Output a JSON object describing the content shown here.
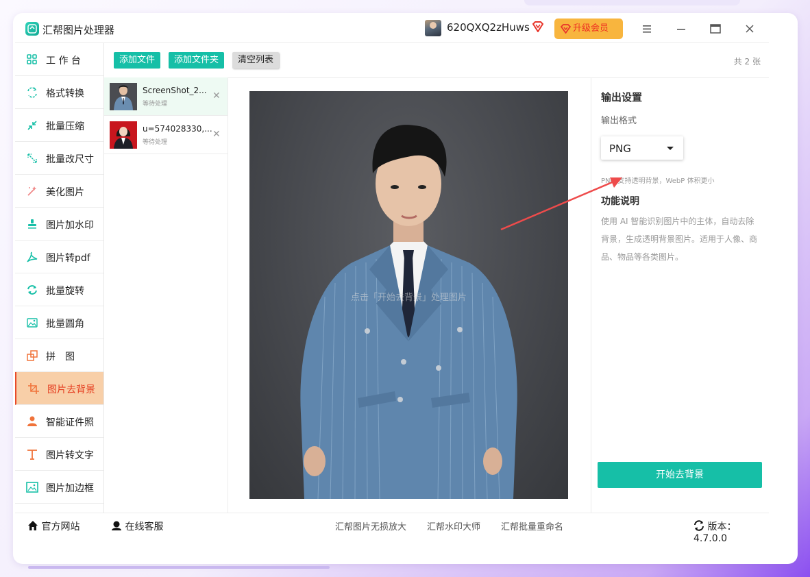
{
  "app": {
    "title": "汇帮图片处理器",
    "username": "620QXQ2zHuws",
    "upgrade_label": "升级会员"
  },
  "sidebar": {
    "items": [
      {
        "label": "工 作 台",
        "icon": "grid-icon"
      },
      {
        "label": "格式转换",
        "icon": "format-convert-icon"
      },
      {
        "label": "批量压缩",
        "icon": "compress-icon"
      },
      {
        "label": "批量改尺寸",
        "icon": "resize-icon"
      },
      {
        "label": "美化图片",
        "icon": "beautify-icon"
      },
      {
        "label": "图片加水印",
        "icon": "watermark-icon"
      },
      {
        "label": "图片转pdf",
        "icon": "pdf-icon"
      },
      {
        "label": "批量旋转",
        "icon": "rotate-icon"
      },
      {
        "label": "批量圆角",
        "icon": "rounded-corner-icon"
      },
      {
        "label": "拼　图",
        "icon": "puzzle-icon"
      },
      {
        "label": "图片去背景",
        "icon": "crop-icon",
        "active": true
      },
      {
        "label": "智能证件照",
        "icon": "person-icon"
      },
      {
        "label": "图片转文字",
        "icon": "text-icon"
      },
      {
        "label": "图片加边框",
        "icon": "frame-icon"
      }
    ]
  },
  "toolbar": {
    "add_file": "添加文件",
    "add_folder": "添加文件夹",
    "clear_list": "清空列表",
    "count": "共 2 张"
  },
  "files": [
    {
      "name": "ScreenShot_2...",
      "status": "等待处理"
    },
    {
      "name": "u=574028330,...",
      "status": "等待处理"
    }
  ],
  "preview": {
    "hint": "点击「开始去背景」处理图片"
  },
  "settings": {
    "title": "输出设置",
    "format_label": "输出格式",
    "format_value": "PNG",
    "tip": "PNG 支持透明背景，WebP 体积更小",
    "feature_title": "功能说明",
    "feature_desc": "使用 AI 智能识别图片中的主体，自动去除背景，生成透明背景图片。适用于人像、商品、物品等各类图片。",
    "start_button": "开始去背景"
  },
  "footer": {
    "website": "官方网站",
    "support": "在线客服",
    "links": [
      "汇帮图片无损放大",
      "汇帮水印大师",
      "汇帮批量重命名"
    ],
    "version": "版本：4.7.0.0"
  },
  "colors": {
    "accent": "#16bfa7",
    "active_bg": "#f8cfa8",
    "active_text": "#e53d1f",
    "vip": "#f8b53e"
  }
}
